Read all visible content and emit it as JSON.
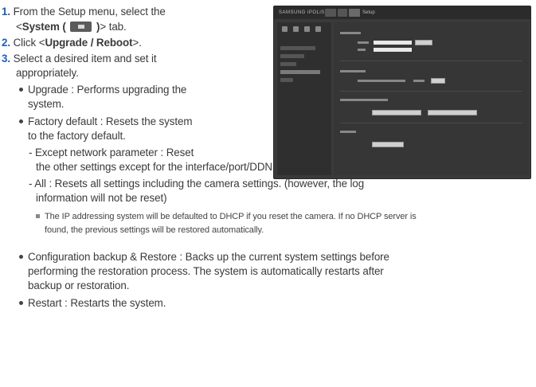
{
  "steps": {
    "s1_num": "1.",
    "s1_a": "From the Setup menu, select the",
    "s1_b_pre": "<",
    "s1_b_bold": "System ( ",
    "s1_b_bold2": " )",
    "s1_b_post": "> tab.",
    "s2_num": "2.",
    "s2_pre": "Click <",
    "s2_bold": "Upgrade / Reboot",
    "s2_post": ">.",
    "s3_num": "3.",
    "s3_a": "Select a desired item and set it",
    "s3_b": "appropriately."
  },
  "items": {
    "upgrade_a": "Upgrade : Performs upgrading the",
    "upgrade_b": "system.",
    "factory_a": "Factory default : Resets the system",
    "factory_b": "to the factory default.",
    "except_a": "- Except network parameter : Reset",
    "except_b": "the other settings except for the interface/port/DDNS/IP filtering settings.",
    "all_a": "- All : Resets all settings including the camera settings. (however, the log",
    "all_b": "information will not be reset)",
    "note_a": "The IP addressing system will be defaulted to DHCP if you reset the camera. If no DHCP server is",
    "note_b": "found, the previous settings will be restored automatically.",
    "backup_a": "Configuration backup & Restore : Backs up the current system settings before",
    "backup_b": "performing the restoration process. The system is automatically restarts after",
    "backup_c": "backup or restoration.",
    "restart": "Restart : Restarts the system."
  },
  "screenshot": {
    "logo": "SAMSUNG iPOLiS",
    "tab_title": "Setup"
  }
}
